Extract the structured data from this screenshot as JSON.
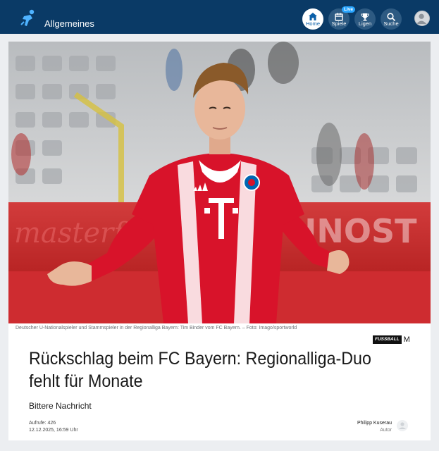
{
  "header": {
    "section_title": "Allgemeines",
    "nav": [
      {
        "label": "Home",
        "icon": "home-icon",
        "active": true
      },
      {
        "label": "Spiele",
        "icon": "calendar-icon",
        "badge": "Live"
      },
      {
        "label": "Ligen",
        "icon": "trophy-icon"
      },
      {
        "label": "Suche",
        "icon": "search-icon"
      }
    ],
    "profile_icon": "user-icon"
  },
  "article": {
    "image_caption": "Deutscher U-Nationalspieler und Stammspieler in der Regionalliga Bayern: Tim Binder vom FC Bayern. – Foto: Imago/sportworld",
    "publisher_logo_text": "FUSSBALL",
    "publisher_logo_mark": "M",
    "headline": "Rückschlag beim FC Bayern: Regionalliga-Duo fehlt für Monate",
    "subheadline": "Bittere Nachricht",
    "views": "Aufrufe: 426",
    "date": "12.12.2025, 16:59 Uhr",
    "author_name": "Philipp Kuserau",
    "author_role": "Autor",
    "jersey_letter": "T"
  },
  "colors": {
    "header_bg": "#0a3a66",
    "accent": "#2aa6ff",
    "jersey_red": "#d8132a"
  }
}
